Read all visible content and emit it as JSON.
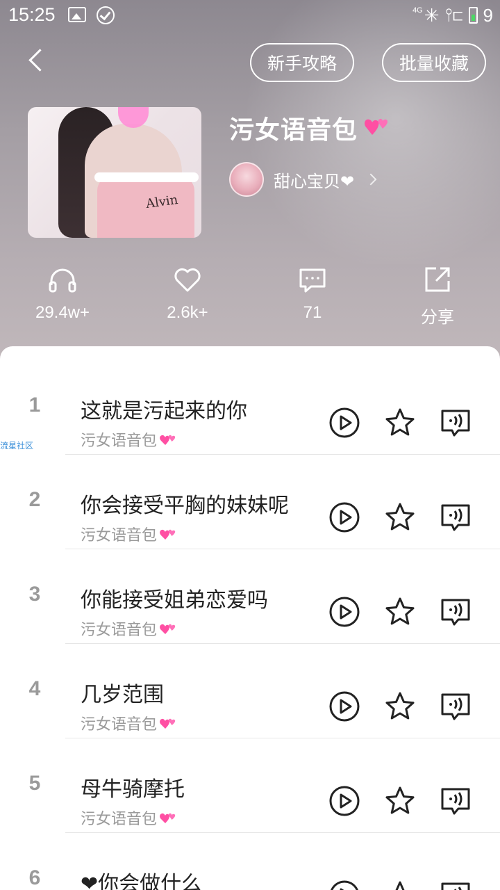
{
  "status_bar": {
    "time": "15:25",
    "network": "4G",
    "battery_level": "9"
  },
  "header": {
    "guide_label": "新手攻略",
    "collect_label": "批量收藏",
    "title": "污女语音包",
    "cover_text": "Alvin",
    "author": {
      "name": "甜心宝贝❤"
    }
  },
  "stats": {
    "listens": "29.4w+",
    "likes": "2.6k+",
    "comments": "71",
    "share_label": "分享"
  },
  "watermark": "流星社区",
  "tracks": [
    {
      "num": "1",
      "title": "这就是污起来的你",
      "sub": "污女语音包"
    },
    {
      "num": "2",
      "title": "你会接受平胸的妹妹呢",
      "sub": "污女语音包"
    },
    {
      "num": "3",
      "title": "你能接受姐弟恋爱吗",
      "sub": "污女语音包"
    },
    {
      "num": "4",
      "title": "几岁范围",
      "sub": "污女语音包"
    },
    {
      "num": "5",
      "title": "母牛骑摩托",
      "sub": "污女语音包"
    },
    {
      "num": "6",
      "title": "❤你会做什么",
      "sub": ""
    }
  ],
  "colors": {
    "header_bg": "#a49ea4",
    "heart_pink": "#ff4fa3",
    "icon_dark": "#222222"
  }
}
